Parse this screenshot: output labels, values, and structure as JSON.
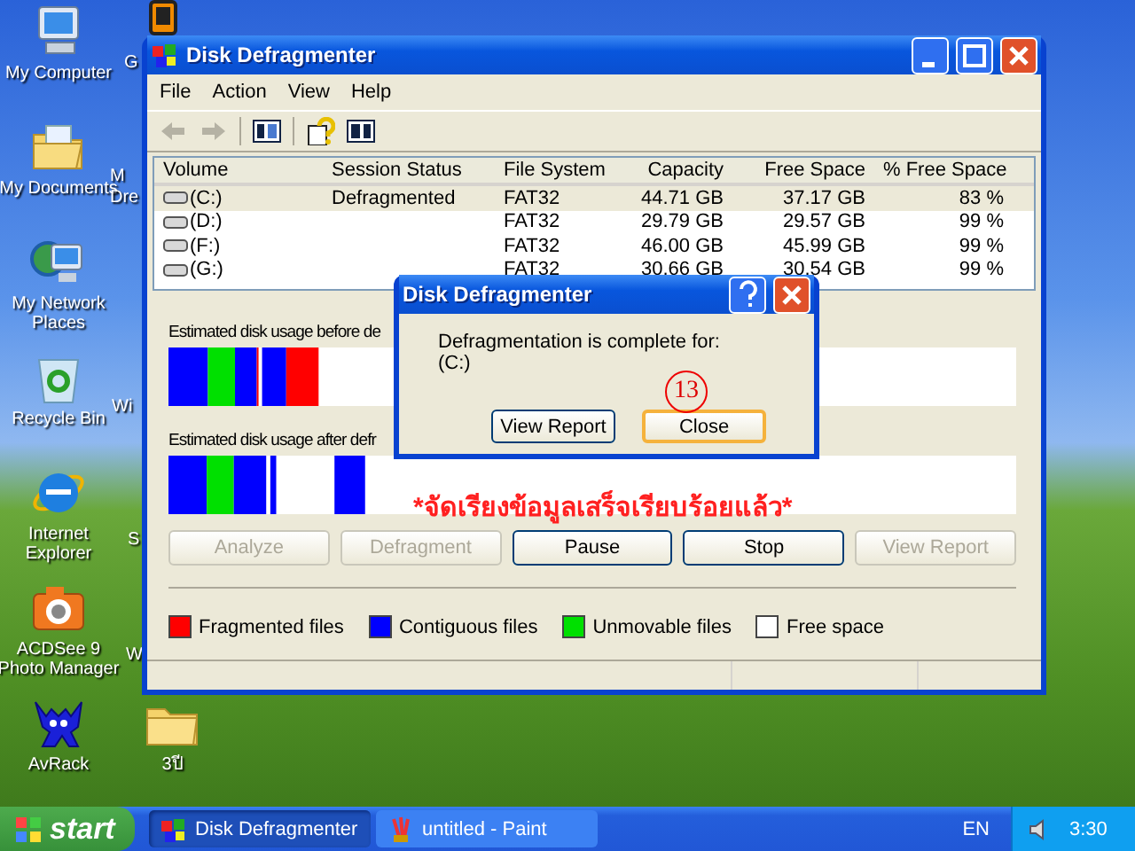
{
  "desktop": {
    "icons": [
      {
        "kind": "computer",
        "label": "My Computer"
      },
      {
        "kind": "documents",
        "label": "My Documents"
      },
      {
        "kind": "network",
        "label": "My Network Places"
      },
      {
        "kind": "recycle",
        "label": "Recycle Bin"
      },
      {
        "kind": "browser",
        "label": "Internet Explorer"
      },
      {
        "kind": "camera",
        "label": "ACDSee 9 Photo Manager"
      },
      {
        "kind": "creature",
        "label": "AvRack"
      },
      {
        "kind": "folder",
        "label": "3ปี"
      }
    ],
    "covered_labels": [
      {
        "lines": [
          "G"
        ]
      },
      {
        "lines": [
          "M",
          "Dre"
        ]
      },
      {
        "lines": [
          "Wi"
        ]
      },
      {
        "lines": [
          "S"
        ]
      },
      {
        "lines": [
          "W"
        ]
      }
    ]
  },
  "window": {
    "title": "Disk Defragmenter",
    "menu": [
      "File",
      "Action",
      "View",
      "Help"
    ],
    "toolbar": [
      {
        "kind": "back",
        "disabled": true
      },
      {
        "kind": "forward",
        "disabled": true
      },
      {
        "kind": "panel"
      },
      {
        "kind": "help"
      },
      {
        "kind": "pane"
      }
    ],
    "table": {
      "columns": [
        "Volume",
        "Session Status",
        "File System",
        "Capacity",
        "Free Space",
        "% Free Space"
      ],
      "rows": [
        {
          "volume": "(C:)",
          "status": "Defragmented",
          "file_system": "FAT32",
          "capacity": "44.71 GB",
          "free_space": "37.17 GB",
          "percent_free": "83 %",
          "selected": true
        },
        {
          "volume": "(D:)",
          "file_system": "FAT32",
          "capacity": "29.79 GB",
          "free_space": "29.57 GB",
          "percent_free": "99 %",
          "selected": false
        },
        {
          "volume": "(F:)",
          "file_system": "FAT32",
          "capacity": "46.00 GB",
          "free_space": "45.99 GB",
          "percent_free": "99 %",
          "selected": false
        },
        {
          "volume": "(G:)",
          "file_system": "FAT32",
          "capacity": "30.66 GB",
          "free_space": "30.54 GB",
          "percent_free": "99 %",
          "selected": false
        }
      ]
    },
    "usage": [
      {
        "label": "Estimated disk usage before de"
      },
      {
        "label": "Estimated disk usage after defr"
      }
    ],
    "buttons": [
      {
        "label": "Analyze",
        "disabled": true
      },
      {
        "label": "Defragment",
        "disabled": true
      },
      {
        "label": "Pause",
        "disabled": false
      },
      {
        "label": "Stop",
        "disabled": false
      },
      {
        "label": "View Report",
        "disabled": true
      }
    ],
    "legend": [
      {
        "label": "Fragmented files",
        "color": "#ff0000"
      },
      {
        "label": "Contiguous files",
        "color": "#0000ff"
      },
      {
        "label": "Unmovable files",
        "color": "#00e000"
      },
      {
        "label": "Free space",
        "color": "#ffffff"
      }
    ]
  },
  "dialog": {
    "title": "Disk Defragmenter",
    "message": [
      "Defragmentation is complete for:",
      "(C:)"
    ],
    "buttons": [
      {
        "label": "View Report",
        "default": false
      },
      {
        "label": "Close",
        "default": true
      }
    ]
  },
  "annotation": {
    "step": "13",
    "caption": "*จัดเรียงข้อมูลเสร็จเรียบร้อยแล้ว*"
  },
  "taskbar": {
    "start": "start",
    "tasks": [
      {
        "kind": "defrag",
        "label": "Disk Defragmenter",
        "selected": true
      },
      {
        "kind": "paint",
        "label": "untitled - Paint",
        "selected": false
      }
    ],
    "language": "EN",
    "clock": "3:30"
  }
}
